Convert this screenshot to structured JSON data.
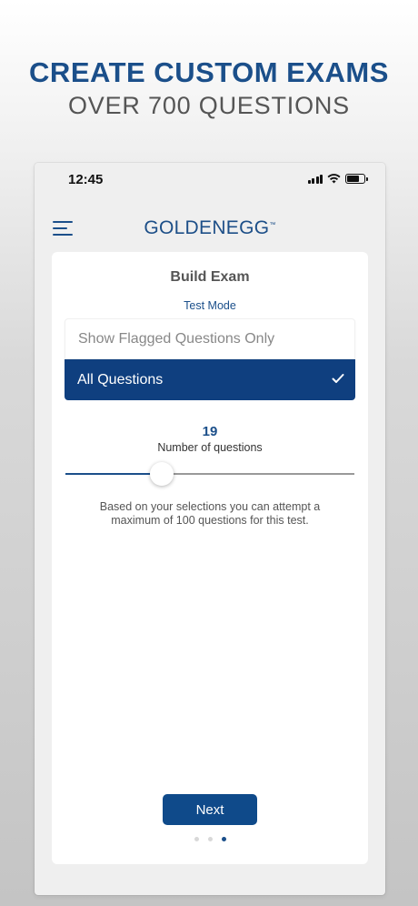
{
  "promo": {
    "headline": "CREATE CUSTOM EXAMS",
    "subheadline": "OVER 700 QUESTIONS"
  },
  "status_bar": {
    "time": "12:45",
    "battery_level": 0.7,
    "signal_bars": 4
  },
  "header": {
    "logo_text": "GOLDENEGG",
    "logo_mark": "™",
    "menu_icon": "hamburger-menu-icon"
  },
  "build_exam": {
    "title": "Build Exam",
    "mode": "Test Mode",
    "options": [
      {
        "label": "Show Flagged Questions Only",
        "selected": false
      },
      {
        "label": "All Questions",
        "selected": true
      }
    ],
    "question_count": "19",
    "question_count_label": "Number of questions",
    "slider": {
      "value": 19,
      "min": 1,
      "max": 100
    },
    "info": "Based on your selections you can attempt a maximum of 100 questions for this test.",
    "next_label": "Next"
  },
  "pagination": {
    "total": 3,
    "current": 3
  },
  "colors": {
    "brand_blue": "#1b4f8a",
    "selected_option": "#0f3f7f",
    "button": "#0f4a8a"
  }
}
